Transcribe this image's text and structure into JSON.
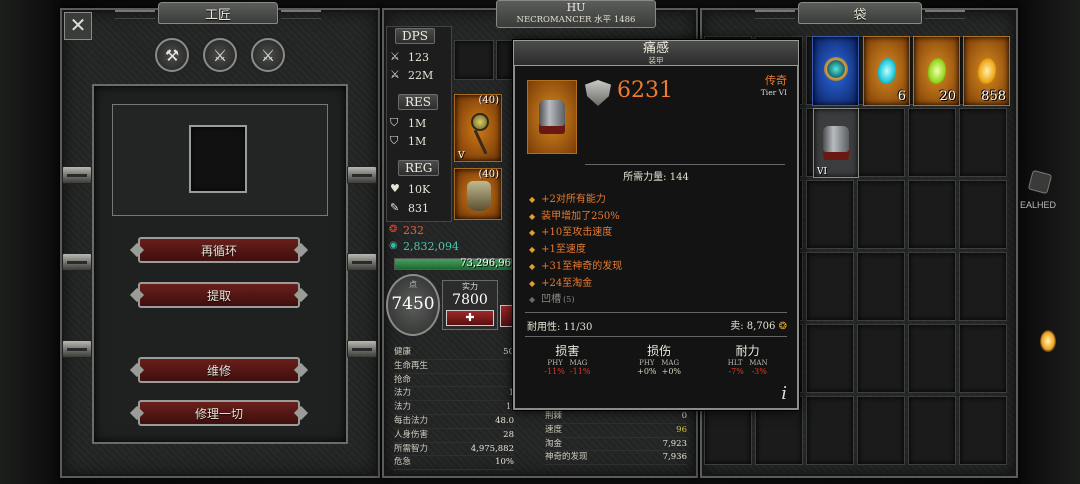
{
  "crafter": {
    "title": "工匠",
    "buttons": {
      "recycle": "再循环",
      "extract": "提取",
      "repair": "维修",
      "repair_all": "修理一切"
    }
  },
  "character": {
    "name": "HU",
    "class_level": "NECROMANCER 水平 1486",
    "dps_label": "DPS",
    "dps_1": "123",
    "dps_2": "22M",
    "res_label": "RES",
    "res_1": "1M",
    "res_2": "1M",
    "reg_label": "REG",
    "reg_1": "10K",
    "reg_2": "831",
    "slot1_level": "(40)",
    "slot1_tier": "V",
    "slot2_level": "(40)",
    "red_stat": "232",
    "teal_stat": "2,832,094",
    "xp": "73,296,96",
    "points_label": "点",
    "points": "7450",
    "strength_label": "实力",
    "strength": "7800",
    "stats": [
      {
        "label": "健康",
        "value": "50"
      },
      {
        "label": "生命再生",
        "value": ""
      },
      {
        "label": "抢命",
        "value": ""
      },
      {
        "label": "法力",
        "value": "1"
      },
      {
        "label": "法力",
        "value": "1,"
      },
      {
        "label": "每击法力",
        "value": "48.0"
      },
      {
        "label": "人身伤害",
        "value": "28"
      },
      {
        "label": "所需智力",
        "value": "4,975,882"
      },
      {
        "label": "危急",
        "value": "10%"
      }
    ],
    "stats_right": [
      {
        "label": "荆棘",
        "value": "0"
      },
      {
        "label": "速度",
        "value": "96"
      },
      {
        "label": "淘金",
        "value": "7,923"
      },
      {
        "label": "神奇的发现",
        "value": "7,936"
      }
    ]
  },
  "tooltip": {
    "name": "痛感",
    "type": "装甲",
    "armor_value": "6231",
    "rarity": "传奇",
    "tier": "Tier VI",
    "requirement": "所需力量: 144",
    "bonuses": [
      "+2对所有能力",
      "装甲增加了250%",
      "+10至攻击速度",
      "+1至速度",
      "+31至神奇的发现",
      "+24至淘金"
    ],
    "socket": "凹槽",
    "socket_count": "(5)",
    "durability": "耐用性: 11/30",
    "sell": "卖: 8,706",
    "compare": [
      {
        "title": "损害",
        "sub": "PHY   MAG",
        "vals": "-11%  -11%",
        "color": "#e03a2a"
      },
      {
        "title": "损伤",
        "sub": "PHY   MAG",
        "vals": "+0%  +0%",
        "color": "#d8d3c6"
      },
      {
        "title": "耐力",
        "sub": "HLT   MAN",
        "vals": "-7%   -3%",
        "color": "#e03a2a"
      }
    ],
    "info_glyph": "i"
  },
  "bag": {
    "title": "袋",
    "items": [
      {
        "count": "6",
        "color": "#34d8e8"
      },
      {
        "count": "20",
        "color": "#a8e030"
      },
      {
        "count": "858",
        "color": "#f0b020"
      }
    ],
    "armor_tier": "VI"
  },
  "side_text": "EALHED"
}
